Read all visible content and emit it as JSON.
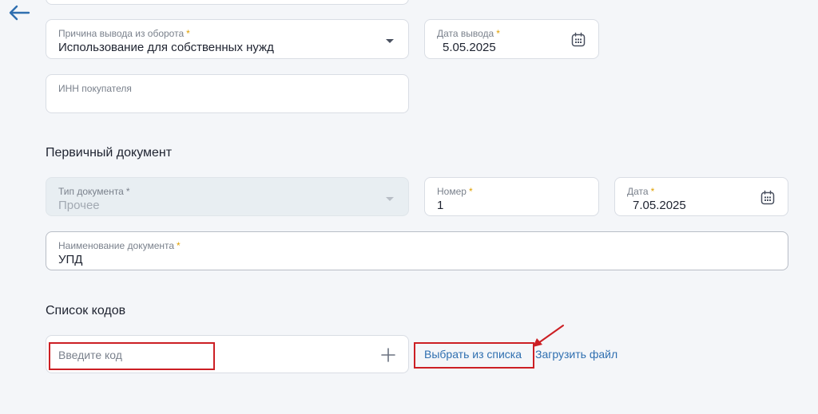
{
  "nav": {
    "back_icon": "arrow-left-icon"
  },
  "removal": {
    "reason": {
      "label": "Причина вывода из оборота",
      "required_mark": "*",
      "value": "Использование для собственных нужд"
    },
    "date": {
      "label": "Дата вывода",
      "required_mark": "*",
      "value": "5.05.2025"
    },
    "inn": {
      "label": "ИНН покупателя",
      "value": ""
    }
  },
  "primary_document": {
    "title": "Первичный документ",
    "doc_type": {
      "label": "Тип документа",
      "required_mark": "*",
      "value": "Прочее"
    },
    "number": {
      "label": "Номер",
      "required_mark": "*",
      "value": "1"
    },
    "date": {
      "label": "Дата",
      "required_mark": "*",
      "value": "7.05.2025"
    },
    "name": {
      "label": "Наименование документа",
      "required_mark": "*",
      "value": "УПД"
    }
  },
  "codes": {
    "title": "Список кодов",
    "input": {
      "placeholder": "Введите код"
    },
    "choose_from_list": "Выбрать из списка",
    "upload_file": "Загрузить файл"
  },
  "colors": {
    "accent": "#2f6fb0",
    "required": "#e0a000",
    "annotation": "#cc1f24",
    "background": "#f4f6f9"
  }
}
